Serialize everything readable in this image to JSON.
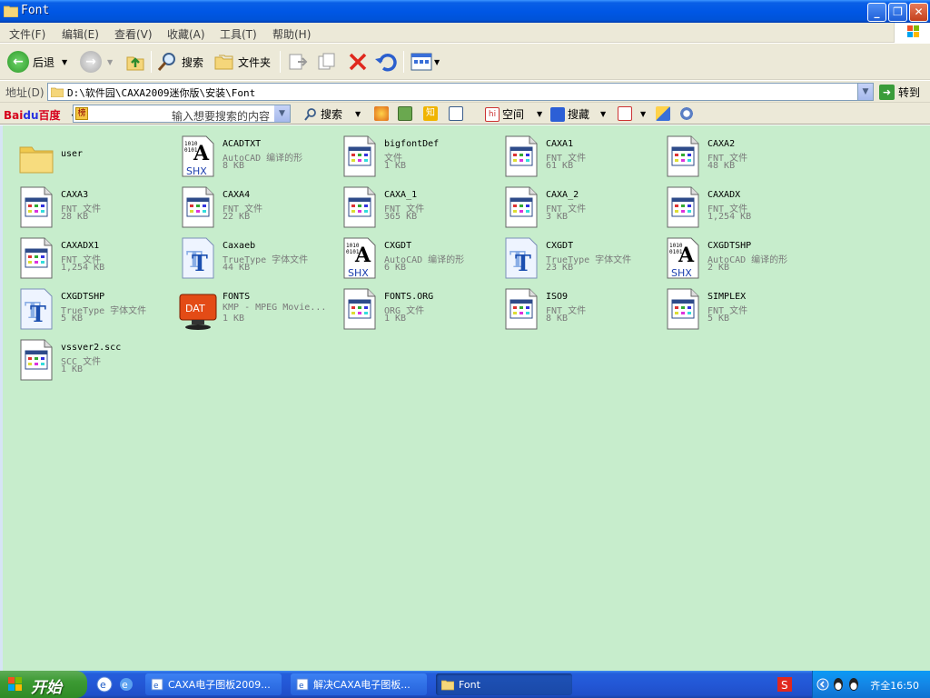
{
  "window": {
    "title": "Font"
  },
  "menu": [
    "文件(F)",
    "编辑(E)",
    "查看(V)",
    "收藏(A)",
    "工具(T)",
    "帮助(H)"
  ],
  "toolbar": {
    "back_label": "后退",
    "search_label": "搜索",
    "folders_label": "文件夹"
  },
  "address": {
    "label": "地址(D)",
    "path": "D:\\软件园\\CAXA2009迷你版\\安装\\Font",
    "go_label": "转到"
  },
  "baidu": {
    "logo": "Bai",
    "logo_b": "du",
    "logo_c": "百度",
    "hot_badge": "榜",
    "placeholder": "输入想要搜索的内容",
    "search_label": "搜索",
    "space_label": "空间",
    "collect_label": "搜藏"
  },
  "files": [
    {
      "name": "user",
      "type": "",
      "size": "",
      "icon": "folder"
    },
    {
      "name": "ACADTXT",
      "type": "AutoCAD 编译的形",
      "size": "8 KB",
      "icon": "shx"
    },
    {
      "name": "bigfontDef",
      "type": "文件",
      "size": "1 KB",
      "icon": "generic"
    },
    {
      "name": "CAXA1",
      "type": "FNT 文件",
      "size": "61 KB",
      "icon": "generic"
    },
    {
      "name": "CAXA2",
      "type": "FNT 文件",
      "size": "48 KB",
      "icon": "generic"
    },
    {
      "name": "CAXA3",
      "type": "FNT 文件",
      "size": "28 KB",
      "icon": "generic"
    },
    {
      "name": "CAXA4",
      "type": "FNT 文件",
      "size": "22 KB",
      "icon": "generic"
    },
    {
      "name": "CAXA_1",
      "type": "FNT 文件",
      "size": "365 KB",
      "icon": "generic"
    },
    {
      "name": "CAXA_2",
      "type": "FNT 文件",
      "size": "3 KB",
      "icon": "generic"
    },
    {
      "name": "CAXADX",
      "type": "FNT 文件",
      "size": "1,254 KB",
      "icon": "generic"
    },
    {
      "name": "CAXADX1",
      "type": "FNT 文件",
      "size": "1,254 KB",
      "icon": "generic"
    },
    {
      "name": "Caxaeb",
      "type": "TrueType 字体文件",
      "size": "44 KB",
      "icon": "ttf"
    },
    {
      "name": "CXGDT",
      "type": "AutoCAD 编译的形",
      "size": "6 KB",
      "icon": "shx"
    },
    {
      "name": "CXGDT",
      "type": "TrueType 字体文件",
      "size": "23 KB",
      "icon": "ttf"
    },
    {
      "name": "CXGDTSHP",
      "type": "AutoCAD 编译的形",
      "size": "2 KB",
      "icon": "shx"
    },
    {
      "name": "CXGDTSHP",
      "type": "TrueType 字体文件",
      "size": "5 KB",
      "icon": "ttf"
    },
    {
      "name": "FONTS",
      "type": "KMP - MPEG Movie...",
      "size": "1 KB",
      "icon": "dat"
    },
    {
      "name": "FONTS.ORG",
      "type": "ORG 文件",
      "size": "1 KB",
      "icon": "generic"
    },
    {
      "name": "ISO9",
      "type": "FNT 文件",
      "size": "8 KB",
      "icon": "generic"
    },
    {
      "name": "SIMPLEX",
      "type": "FNT 文件",
      "size": "5 KB",
      "icon": "generic"
    },
    {
      "name": "vssver2.scc",
      "type": "SCC 文件",
      "size": "1 KB",
      "icon": "generic"
    }
  ],
  "taskbar": {
    "start_label": "开始",
    "tasks": [
      {
        "label": "CAXA电子图板2009...",
        "active": false
      },
      {
        "label": "解决CAXA电子图板...",
        "active": false
      },
      {
        "label": "Font",
        "active": true
      }
    ],
    "clock": "齐全16:50"
  },
  "colors": {
    "title_blue": "#0057e5",
    "content_bg": "#c7edcc",
    "chrome_bg": "#ece9d8",
    "start_green": "#3c9a33",
    "close_red": "#c3401d"
  }
}
